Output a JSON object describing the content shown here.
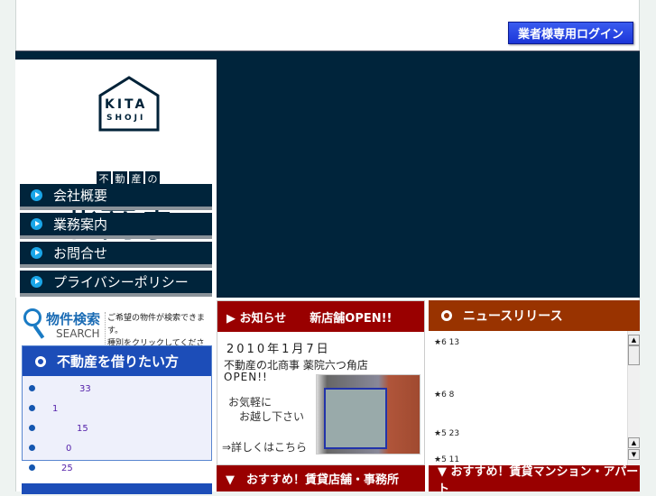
{
  "header": {
    "login_button": "業者様専用ログイン"
  },
  "logo": {
    "kita": "KITA",
    "shoji": "SHOJI",
    "sub": [
      "不",
      "動",
      "産",
      "の"
    ],
    "name": "北商事"
  },
  "menu": [
    "会社概要",
    "業務案内",
    "お問合せ",
    "プライバシーポリシー"
  ],
  "search": {
    "title": "物件検索",
    "title_en": "SEARCH",
    "desc1": "ご希望の物件が検索できます。",
    "desc2": "種別をクリックしてください。"
  },
  "rent": {
    "title": "不動産を借りたい方",
    "counts": [
      "33",
      "1",
      "15",
      "0",
      "25"
    ]
  },
  "notice": {
    "header": "▶ お知らせ　　新店舗OPEN!!",
    "date": "2010年1月7日",
    "line1": "不動産の北商事 薬院六つ角店",
    "line2": "OPEN!!",
    "line3a": "お気軽に",
    "line3b": "　お越し下さい",
    "link": "⇒詳しくはこちら"
  },
  "news": {
    "title": "ニュースリリース",
    "items": [
      "★6 13",
      "★6 8",
      "★5 23",
      "★5 11"
    ]
  },
  "recommend": {
    "shop": "▼　おすすめ！賃貸店舗・事務所",
    "mansion": "▼ おすすめ！賃貸マンション・アパート"
  }
}
